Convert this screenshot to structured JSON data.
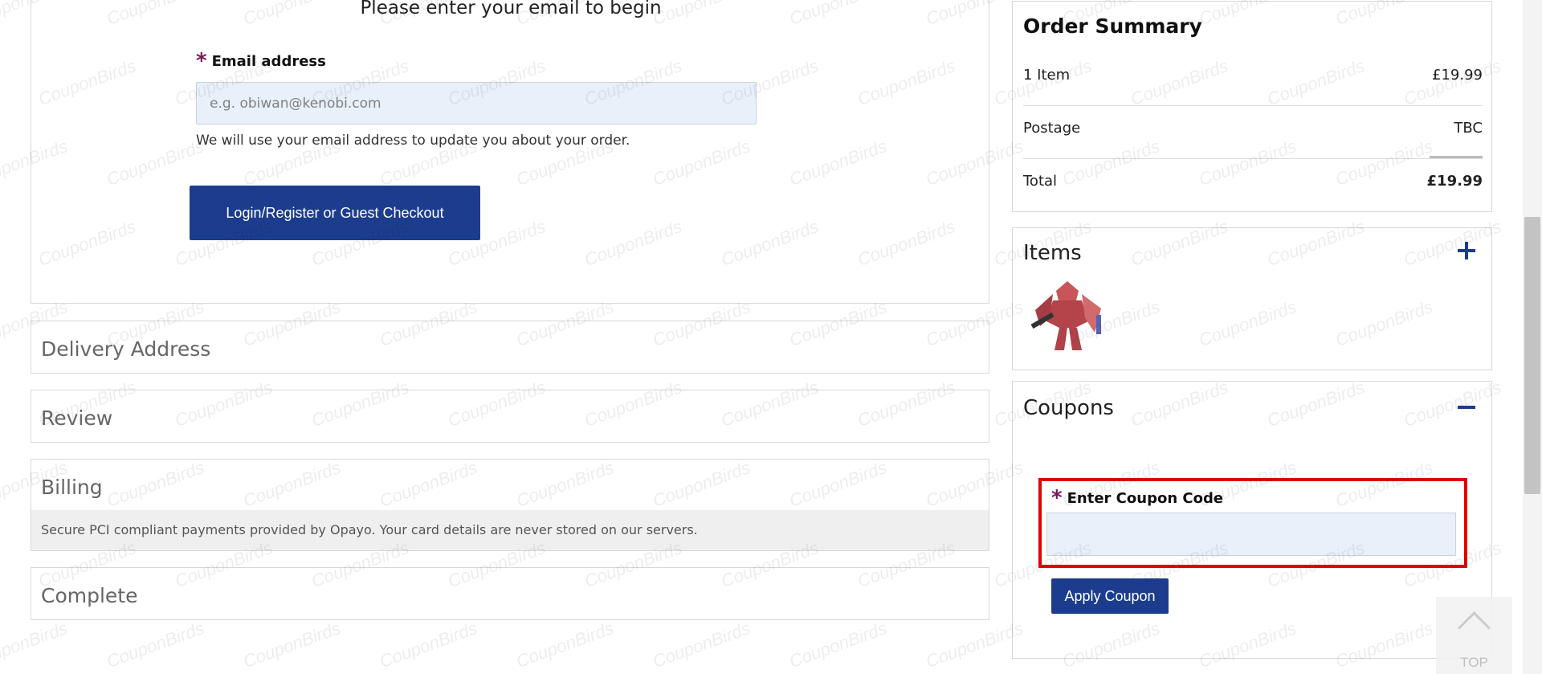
{
  "checkout": {
    "email_heading": "Please enter your email to begin",
    "email_label": "Email address",
    "email_placeholder": "e.g. obiwan@kenobi.com",
    "email_note": "We will use your email address to update you about your order.",
    "login_button": "Login/Register or Guest Checkout",
    "steps": {
      "delivery": "Delivery Address",
      "review": "Review",
      "billing": "Billing",
      "billing_note": "Secure PCI compliant payments provided by Opayo. Your card details are never stored on our servers.",
      "complete": "Complete"
    }
  },
  "order_summary": {
    "title": "Order Summary",
    "rows": [
      {
        "label": "1 Item",
        "value": "£19.99"
      },
      {
        "label": "Postage",
        "value": "TBC"
      },
      {
        "label": "Total",
        "value": "£19.99"
      }
    ]
  },
  "items_panel": {
    "title": "Items",
    "toggle_icon": "plus-icon",
    "thumbnail": "red-robot-figure"
  },
  "coupons": {
    "title": "Coupons",
    "toggle_icon": "minus-icon",
    "label": "Enter Coupon Code",
    "input_value": "",
    "apply_button": "Apply Coupon"
  },
  "back_to_top": {
    "label": "TOP",
    "icon": "chevron-up-icon"
  },
  "required_marker": "*",
  "watermark": "CouponBirds",
  "colors": {
    "primary": "#1c3d8e",
    "input_bg": "#e8f0fa",
    "required": "#7a1457",
    "highlight": "#e30000"
  }
}
